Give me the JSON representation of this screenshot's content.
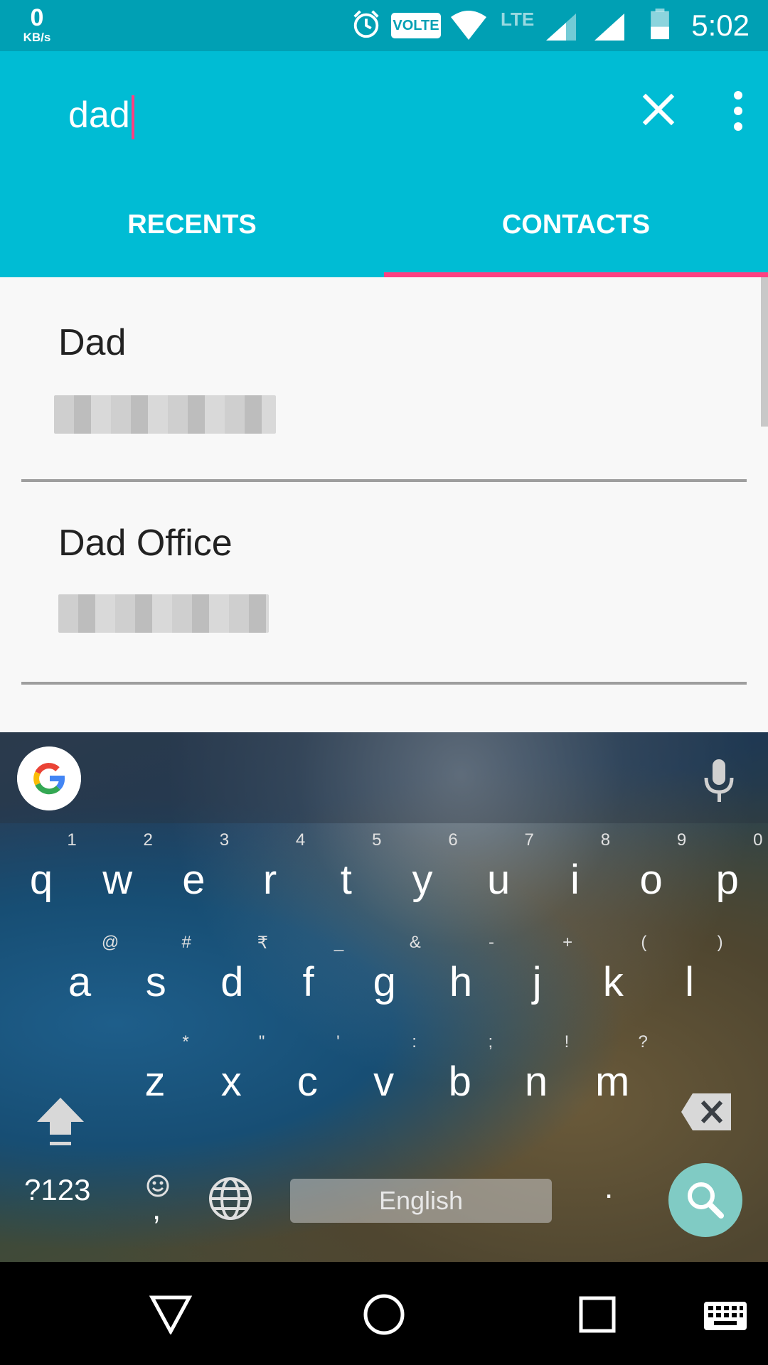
{
  "status_bar": {
    "net_speed_value": "0",
    "net_speed_unit": "KB/s",
    "volte_label": "VOLTE",
    "lte_label": "LTE",
    "time": "5:02"
  },
  "search": {
    "query": "dad"
  },
  "tabs": [
    {
      "label": "RECENTS",
      "selected": false
    },
    {
      "label": "CONTACTS",
      "selected": true
    }
  ],
  "contacts": [
    {
      "name": "Dad"
    },
    {
      "name": "Dad Office"
    }
  ],
  "keyboard": {
    "row1": [
      {
        "key": "q",
        "hint": "1"
      },
      {
        "key": "w",
        "hint": "2"
      },
      {
        "key": "e",
        "hint": "3"
      },
      {
        "key": "r",
        "hint": "4"
      },
      {
        "key": "t",
        "hint": "5"
      },
      {
        "key": "y",
        "hint": "6"
      },
      {
        "key": "u",
        "hint": "7"
      },
      {
        "key": "i",
        "hint": "8"
      },
      {
        "key": "o",
        "hint": "9"
      },
      {
        "key": "p",
        "hint": "0"
      }
    ],
    "row2": [
      {
        "key": "a",
        "hint": "@"
      },
      {
        "key": "s",
        "hint": "#"
      },
      {
        "key": "d",
        "hint": "₹"
      },
      {
        "key": "f",
        "hint": "_"
      },
      {
        "key": "g",
        "hint": "&"
      },
      {
        "key": "h",
        "hint": "-"
      },
      {
        "key": "j",
        "hint": "+"
      },
      {
        "key": "k",
        "hint": "("
      },
      {
        "key": "l",
        "hint": ")"
      }
    ],
    "row3": [
      {
        "key": "z",
        "hint": "*"
      },
      {
        "key": "x",
        "hint": "\""
      },
      {
        "key": "c",
        "hint": "'"
      },
      {
        "key": "v",
        "hint": ":"
      },
      {
        "key": "b",
        "hint": ";"
      },
      {
        "key": "n",
        "hint": "!"
      },
      {
        "key": "m",
        "hint": "?"
      }
    ],
    "symbols_key": "?123",
    "comma_key": ",",
    "space_label": "English",
    "period_key": "."
  },
  "colors": {
    "status_bar": "#00a0b4",
    "app_bar": "#00bcd4",
    "accent": "#ff4081",
    "search_key": "#80cbc4"
  }
}
